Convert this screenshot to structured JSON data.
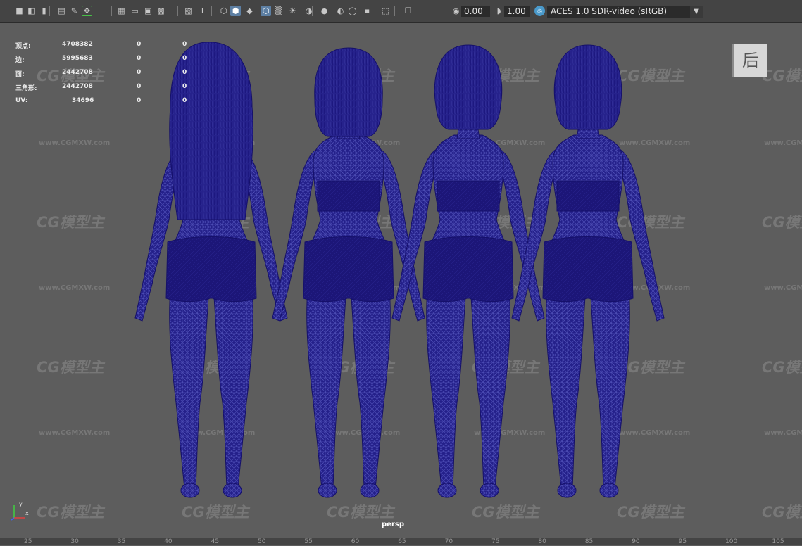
{
  "toolbar": {
    "exposure": "0.00",
    "gamma": "1.00",
    "color_management": "ACES 1.0 SDR-video (sRGB)",
    "icons": [
      "camera-icon",
      "camera-attr-icon",
      "bookmark-icon",
      "image-plane-icon",
      "grease-pencil-icon",
      "2d-pan-icon",
      "grid-icon",
      "film-gate-icon",
      "resolution-gate-icon",
      "gate-mask-icon",
      "field-chart-icon",
      "safe-title-icon",
      "wireframe-icon",
      "smooth-shade-icon",
      "default-material-icon",
      "wireframe-on-shaded-icon",
      "xray-icon",
      "use-lights-icon",
      "shadows-icon",
      "ambient-occlusion-icon",
      "motion-blur-icon",
      "anti-alias-icon",
      "isolate-select-icon",
      "xray-joints-icon",
      "xray-active-icon",
      "exposure-icon",
      "gamma-icon",
      "color-management-icon"
    ]
  },
  "hud": {
    "rows": [
      {
        "label": "顶点:",
        "v1": "4708382",
        "v2": "0",
        "v3": "0"
      },
      {
        "label": "边:",
        "v1": "5995683",
        "v2": "0",
        "v3": "0"
      },
      {
        "label": "面:",
        "v1": "2442708",
        "v2": "0",
        "v3": "0"
      },
      {
        "label": "三角形:",
        "v1": "2442708",
        "v2": "0",
        "v3": "0"
      },
      {
        "label": "UV:",
        "v1": "34696",
        "v2": "0",
        "v3": "0"
      }
    ]
  },
  "view_cube": {
    "label": "后"
  },
  "camera_label": "persp",
  "axis": {
    "x": "x",
    "y": "y",
    "colors": {
      "x": "#e04040",
      "y": "#40d040",
      "z": "#4060ff"
    }
  },
  "timeline": {
    "ticks": [
      "25",
      "30",
      "35",
      "40",
      "45",
      "50",
      "55",
      "60",
      "65",
      "70",
      "75",
      "80",
      "85",
      "90",
      "95",
      "100",
      "105"
    ]
  },
  "watermark": {
    "logo": "CG模型主",
    "url": "www.CGMXW.com"
  },
  "colors": {
    "wire": "#1c1678",
    "wire_line": "#4a4ab0",
    "viewport_bg": "#5d5d5d"
  }
}
